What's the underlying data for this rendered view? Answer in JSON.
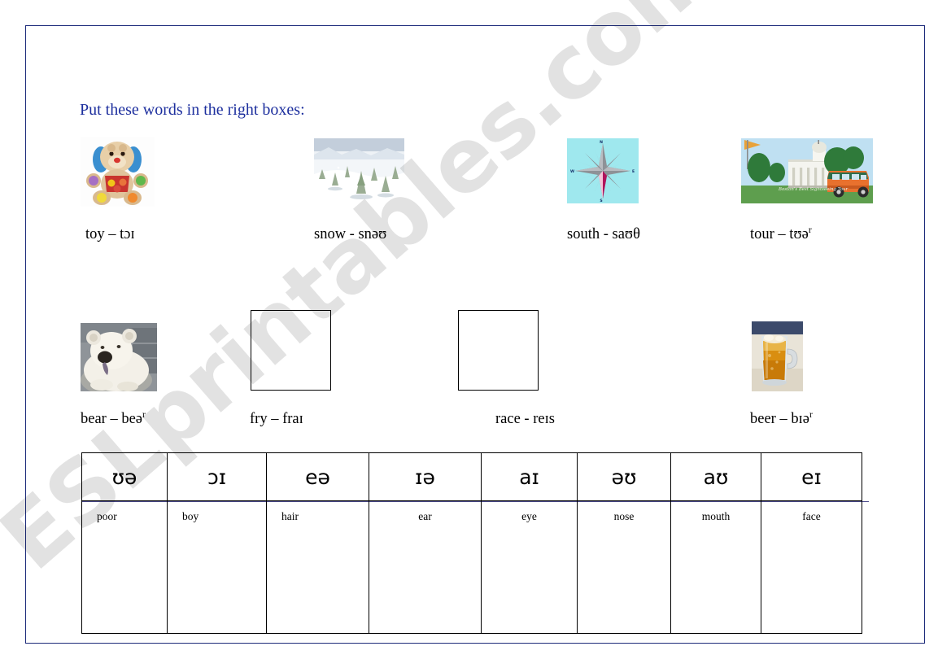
{
  "page": {
    "border_color": "#1c2a7a",
    "background": "#ffffff"
  },
  "watermark": {
    "text": "ESLprintables.com"
  },
  "instruction": {
    "text": "Put these words in the right boxes:",
    "color": "#1d2f9e"
  },
  "word_items": [
    {
      "id": "toy",
      "word": "toy",
      "separator": "–",
      "ipa": "tɔɪ",
      "superscript": "",
      "label": "toy – tɔɪ",
      "picture": "plush-toy-dog-photo",
      "has_picture": true
    },
    {
      "id": "snow",
      "word": "snow",
      "separator": "-",
      "ipa": "snəʊ",
      "superscript": "",
      "label": "snow - snəʊ",
      "picture": "snowy-winter-landscape-photo",
      "has_picture": true
    },
    {
      "id": "south",
      "word": "south",
      "separator": "-",
      "ipa": "saʊθ",
      "superscript": "",
      "label": "south - saʊθ",
      "picture": "compass-rose-image",
      "has_picture": true
    },
    {
      "id": "tour",
      "word": "tour",
      "separator": "–",
      "ipa": "tʊə",
      "superscript": "r",
      "label": "tour – tʊə",
      "picture": "tour-trolley-bus-photo",
      "has_picture": true
    },
    {
      "id": "bear",
      "word": "bear",
      "separator": "–",
      "ipa": "beə",
      "superscript": "r",
      "label": "bear – beə",
      "picture": "polar-bear-photo",
      "has_picture": true
    },
    {
      "id": "fry",
      "word": "fry",
      "separator": "–",
      "ipa": "fraɪ",
      "superscript": "",
      "label": "fry –  fraɪ",
      "picture": "empty-placeholder-box",
      "has_picture": false
    },
    {
      "id": "race",
      "word": "race",
      "separator": "-",
      "ipa": "reɪs",
      "superscript": "",
      "label": "race - reɪs",
      "picture": "empty-placeholder-box",
      "has_picture": false
    },
    {
      "id": "beer",
      "word": "beer",
      "separator": "–",
      "ipa": "bɪə",
      "superscript": "r",
      "label": "beer – bɪə",
      "picture": "beer-mug-photo",
      "has_picture": true
    }
  ],
  "ipa_table": {
    "headers": [
      "ʊə",
      "ɔɪ",
      "eə",
      "ɪə",
      "aɪ",
      "əʊ",
      "aʊ",
      "eɪ"
    ],
    "answers": [
      "poor",
      "boy",
      "hair",
      "ear",
      "eye",
      "nose",
      "mouth",
      "face"
    ]
  }
}
